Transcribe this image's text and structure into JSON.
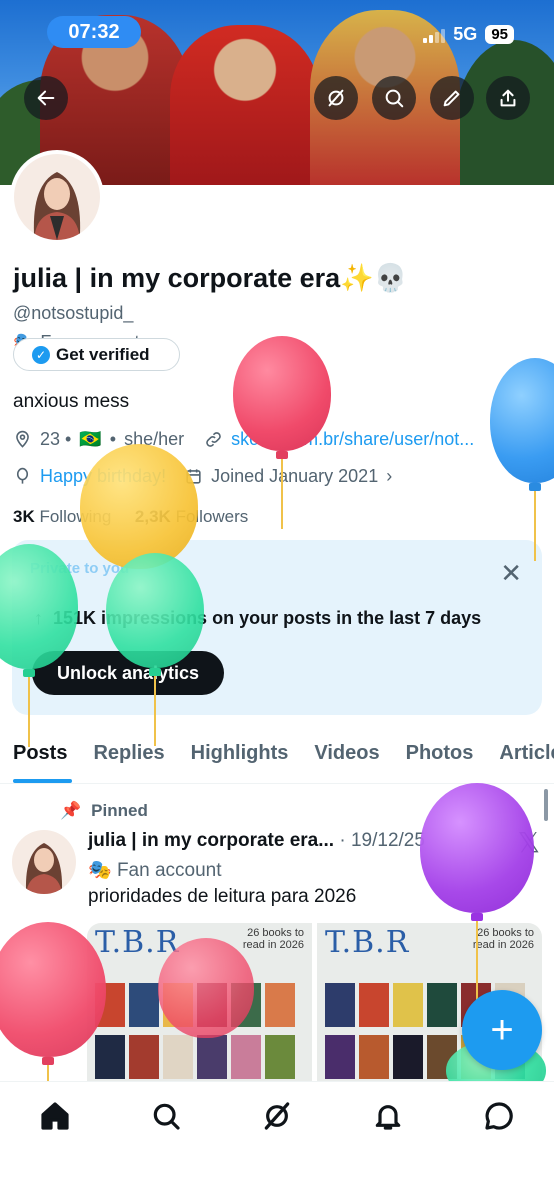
{
  "status": {
    "time": "07:32",
    "network": "5G",
    "battery": "95"
  },
  "profile": {
    "name": "julia | in my corporate era✨💀",
    "handle": "@notsostupid_",
    "category": "Fan account",
    "verify_label": "Get verified",
    "bio": "anxious mess",
    "meta": {
      "age": "23 •",
      "flag": "🇧🇷",
      "sep": "•",
      "pronouns": "she/her",
      "link": "skoob.com.br/share/user/not...",
      "birthday": "Happy birthday!",
      "joined": "Joined January 2021"
    },
    "following_count": "3K",
    "following_label": "Following",
    "followers_count": "2,3K",
    "followers_label": "Followers"
  },
  "analytics": {
    "private_label": "Private to you",
    "impressions": "151K impressions on your posts in the last 7 days",
    "unlock_label": "Unlock analytics"
  },
  "tabs": [
    "Posts",
    "Replies",
    "Highlights",
    "Videos",
    "Photos",
    "Articles"
  ],
  "post": {
    "pinned_label": "Pinned",
    "author": "julia | in my corporate era...",
    "date": "· 19/12/25",
    "category": "Fan account",
    "text": "prioridades de leitura para 2026",
    "image_title": "T.B.R",
    "image_sub": "26 books to read in 2026"
  },
  "colors": {
    "accent": "#1d9bf0",
    "text": "#0f1419",
    "muted": "#536471"
  }
}
